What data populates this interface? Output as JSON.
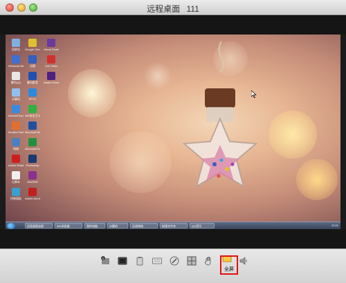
{
  "window": {
    "title_left": "远程桌面",
    "title_right": "111"
  },
  "desktop": {
    "icons": [
      {
        "label": "回收站",
        "color": "#7fb0e0"
      },
      {
        "label": "Windows Media",
        "color": "#3f6fd0"
      },
      {
        "label": "腾讯QQ",
        "color": "#e8e8e8"
      },
      {
        "label": "计算机",
        "color": "#8fc0f0"
      },
      {
        "label": "Internet Explorer",
        "color": "#3a8ae0"
      },
      {
        "label": "Mozilla Firefox",
        "color": "#e07030"
      },
      {
        "label": "网络",
        "color": "#4a80c0"
      },
      {
        "label": "Adobe Reader",
        "color": "#cc2020"
      },
      {
        "label": "记事本",
        "color": "#f0f0f0"
      },
      {
        "label": "控制面板",
        "color": "#3aa0d0"
      },
      {
        "label": "Google Chrome",
        "color": "#e0c030"
      },
      {
        "label": "迅雷",
        "color": "#3060c0"
      },
      {
        "label": "暴风影音",
        "color": "#2050b0"
      },
      {
        "label": "PPTV",
        "color": "#2a8ae0"
      },
      {
        "label": "360安全卫士",
        "color": "#30b040"
      },
      {
        "label": "Microsoft Word",
        "color": "#2050a0"
      },
      {
        "label": "Microsoft Excel",
        "color": "#209040"
      },
      {
        "label": "Photoshop",
        "color": "#1a3a70"
      },
      {
        "label": "WinRAR",
        "color": "#8a3090"
      },
      {
        "label": "Adobe Acrobat",
        "color": "#c02020"
      },
      {
        "label": "Visual Studio",
        "color": "#6a3aa0"
      },
      {
        "label": "Live Video",
        "color": "#d03030"
      },
      {
        "label": "Adobe Premiere",
        "color": "#502080"
      }
    ],
    "taskbar": {
      "items": [
        "远程桌面连接",
        "360浏览器",
        "我的电脑",
        "计算机",
        "无线网络",
        "新建文件夹",
        "QQ音乐"
      ],
      "clock": "12:01"
    }
  },
  "toolbar": {
    "buttons": [
      {
        "name": "connection-info-icon"
      },
      {
        "name": "display-icon"
      },
      {
        "name": "clipboard-icon"
      },
      {
        "name": "keyboard-icon"
      },
      {
        "name": "screenshot-icon"
      },
      {
        "name": "grid-icon"
      },
      {
        "name": "hand-icon"
      },
      {
        "name": "fullscreen-icon"
      },
      {
        "name": "sound-icon"
      }
    ],
    "tooltip": "全屏"
  },
  "colors": {
    "highlight": "#e01010"
  }
}
